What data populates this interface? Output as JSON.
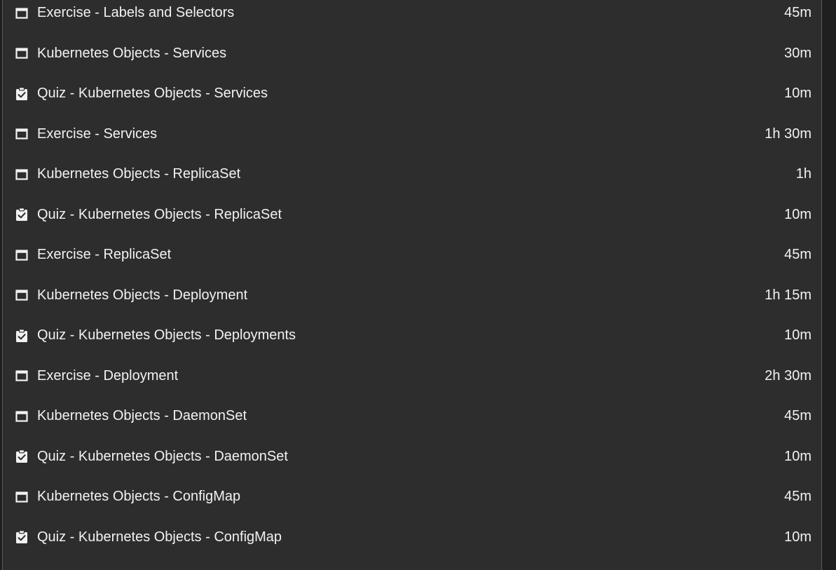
{
  "items": [
    {
      "type": "lesson",
      "icon": "window-icon",
      "title": "Exercise - Labels and Selectors",
      "duration": "45m"
    },
    {
      "type": "lesson",
      "icon": "window-icon",
      "title": "Kubernetes Objects - Services",
      "duration": "30m"
    },
    {
      "type": "quiz",
      "icon": "clipboard-check-icon",
      "title": "Quiz - Kubernetes Objects - Services",
      "duration": "10m"
    },
    {
      "type": "lesson",
      "icon": "window-icon",
      "title": "Exercise - Services",
      "duration": "1h 30m"
    },
    {
      "type": "lesson",
      "icon": "window-icon",
      "title": "Kubernetes Objects - ReplicaSet",
      "duration": "1h"
    },
    {
      "type": "quiz",
      "icon": "clipboard-check-icon",
      "title": "Quiz - Kubernetes Objects - ReplicaSet",
      "duration": "10m"
    },
    {
      "type": "lesson",
      "icon": "window-icon",
      "title": "Exercise - ReplicaSet",
      "duration": "45m"
    },
    {
      "type": "lesson",
      "icon": "window-icon",
      "title": "Kubernetes Objects - Deployment",
      "duration": "1h 15m"
    },
    {
      "type": "quiz",
      "icon": "clipboard-check-icon",
      "title": "Quiz - Kubernetes Objects - Deployments",
      "duration": "10m"
    },
    {
      "type": "lesson",
      "icon": "window-icon",
      "title": "Exercise - Deployment",
      "duration": "2h 30m"
    },
    {
      "type": "lesson",
      "icon": "window-icon",
      "title": "Kubernetes Objects - DaemonSet",
      "duration": "45m"
    },
    {
      "type": "quiz",
      "icon": "clipboard-check-icon",
      "title": "Quiz - Kubernetes Objects - DaemonSet",
      "duration": "10m"
    },
    {
      "type": "lesson",
      "icon": "window-icon",
      "title": "Kubernetes Objects - ConfigMap",
      "duration": "45m"
    },
    {
      "type": "quiz",
      "icon": "clipboard-check-icon",
      "title": "Quiz - Kubernetes Objects - ConfigMap",
      "duration": "10m"
    }
  ],
  "colors": {
    "background": "#2d2d2d",
    "text": "#f2f2f2",
    "border": "#5a5a5a"
  }
}
